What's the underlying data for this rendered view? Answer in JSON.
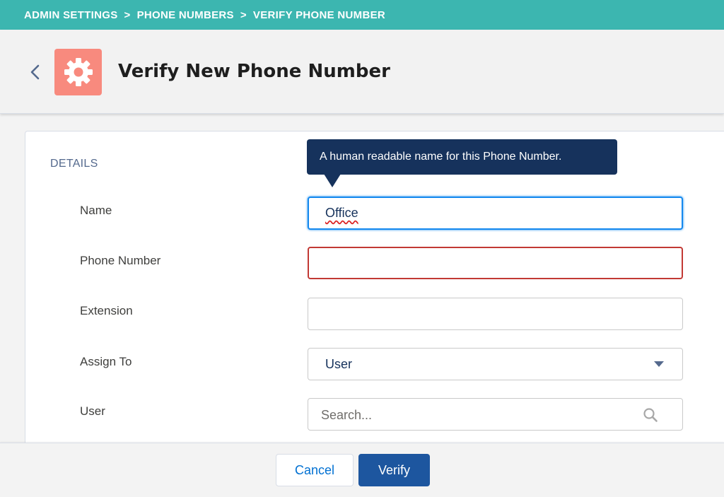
{
  "breadcrumb": {
    "items": [
      "ADMIN SETTINGS",
      "PHONE NUMBERS",
      "VERIFY PHONE NUMBER"
    ],
    "separator": ">"
  },
  "header": {
    "title": "Verify New Phone Number",
    "back_icon": "chevron-left-icon",
    "app_icon": "gear-icon"
  },
  "form": {
    "section_label": "DETAILS",
    "tooltip": "A human readable name for this Phone Number.",
    "fields": {
      "name": {
        "label": "Name",
        "value": "Office"
      },
      "phone": {
        "label": "Phone Number",
        "value": ""
      },
      "extension": {
        "label": "Extension",
        "value": ""
      },
      "assign_to": {
        "label": "Assign To",
        "selected": "User"
      },
      "user": {
        "label": "User",
        "placeholder": "Search..."
      }
    }
  },
  "footer": {
    "cancel_label": "Cancel",
    "verify_label": "Verify"
  },
  "colors": {
    "breadcrumb_bg": "#3cb6b0",
    "app_icon_bg": "#f88a7e",
    "tooltip_bg": "#16325c",
    "primary_button": "#1d569f",
    "error_border": "#c23934",
    "focus_border": "#1589ee"
  }
}
